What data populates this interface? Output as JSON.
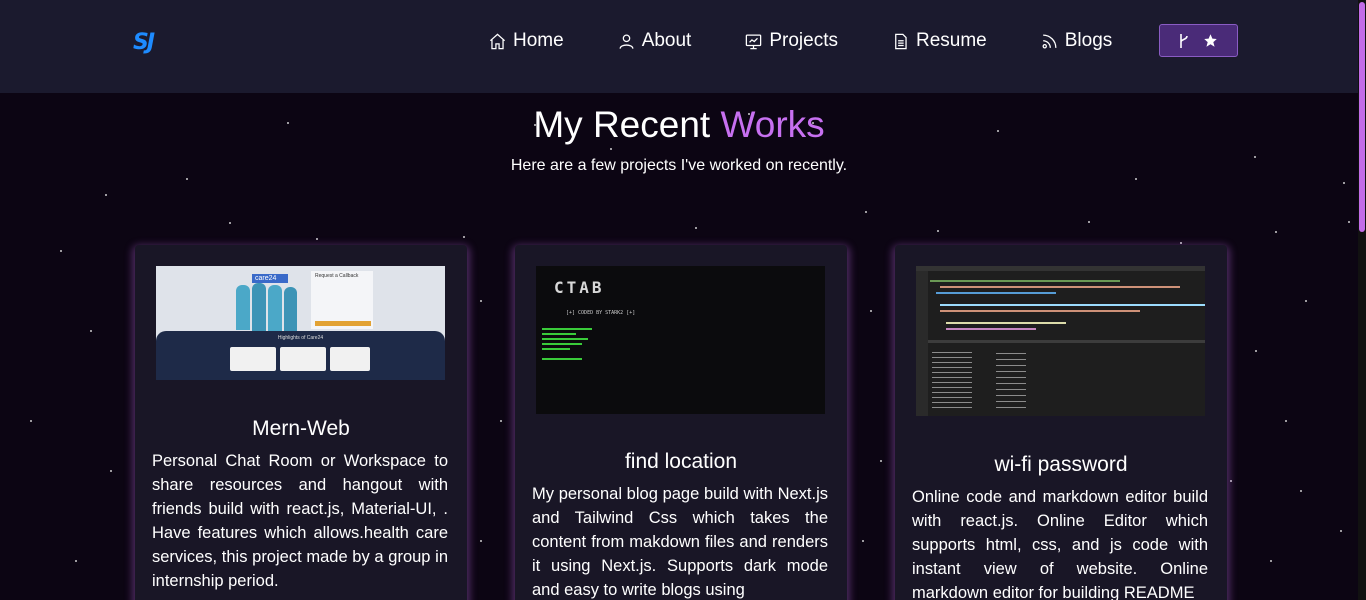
{
  "nav": {
    "logo": "SJ",
    "items": [
      {
        "label": "Home",
        "icon": "home-icon"
      },
      {
        "label": "About",
        "icon": "user-icon"
      },
      {
        "label": "Projects",
        "icon": "projects-icon"
      },
      {
        "label": "Resume",
        "icon": "resume-icon"
      },
      {
        "label": "Blogs",
        "icon": "blogs-icon"
      }
    ],
    "github_button": {
      "icons": [
        "fork-icon",
        "star-icon"
      ]
    }
  },
  "heading": {
    "main": "My Recent ",
    "accent": "Works"
  },
  "subheading": "Here are a few projects I've worked on recently.",
  "projects": [
    {
      "title": "Mern-Web",
      "description": "Personal Chat Room or Workspace to share resources and hangout with friends build with react.js, Material-UI, . Have features which allows.health care services, this project made by a group in internship period.",
      "thumbnail": {
        "brand": "care24",
        "form_title": "Request a Callback",
        "banner": "Highlights of Care24"
      }
    },
    {
      "title": "find location",
      "description": "My personal blog page build with Next.js and Tailwind Css which takes the content from makdown files and renders it using Next.js. Supports dark mode and easy to write blogs using",
      "thumbnail": {
        "ascii": "CTAB",
        "tagline": "[+] CODED BY STARK2 [+]"
      }
    },
    {
      "title": "wi-fi password",
      "description": "Online code and markdown editor build with react.js. Online Editor which supports html, css, and js code with instant view of website. Online markdown editor for building README"
    }
  ],
  "colors": {
    "accent": "#c770f0",
    "nav_bg": "#1b1a2e",
    "page_bg": "#0c0513",
    "logo": "#1e8bff",
    "button_bg": "#4a2b78"
  }
}
